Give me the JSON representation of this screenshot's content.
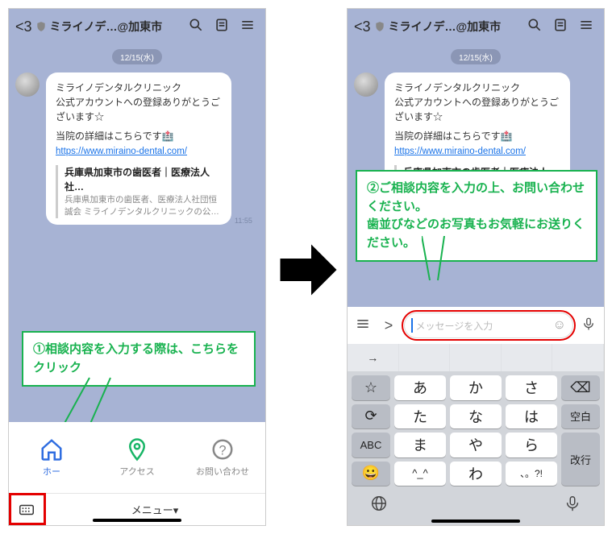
{
  "header": {
    "back_count": "3",
    "title": "ミライノデ…@加東市"
  },
  "date_label": "12/15(水)",
  "message": {
    "line1": "ミライノデンタルクリニック",
    "line2": "公式アカウントへの登録ありがとうございます☆",
    "line3_prefix": "当院の詳細はこちらです",
    "url": "https://www.miraino-dental.com/",
    "card_title": "兵庫県加東市の歯医者｜医療法人社…",
    "card_desc_left": "兵庫県加東市の歯医者、医療法人社団恒誠会 ミライノデンタルクリニックの公…",
    "card_desc_right": "兵庫県加東市の歯医者、医療法人社団恒",
    "time": "11:55"
  },
  "callout1": "①相談内容を入力する際は、こちらをクリック",
  "callout2": "②ご相談内容を入力の上、お問い合わせください。\n歯並びなどのお写真もお気軽にお送りください。",
  "rich_menu": {
    "home": "ホー",
    "access": "アクセス",
    "contact": "お問い合わせ"
  },
  "bottom": {
    "menu_label": "メニュー▾"
  },
  "input": {
    "placeholder": "メッセージを入力"
  },
  "suggestions": [
    "→",
    "",
    "",
    "",
    ""
  ],
  "keys": {
    "r1": [
      "あ",
      "か",
      "さ"
    ],
    "r2": [
      "た",
      "な",
      "は"
    ],
    "r3": [
      "ま",
      "や",
      "ら"
    ],
    "r4": [
      "^_^",
      "わ",
      "、。?!"
    ],
    "left": [
      "☆",
      "⟳",
      "ABC",
      "😀"
    ],
    "right_del": "⌫",
    "right_space": "空白",
    "right_enter": "改行"
  }
}
